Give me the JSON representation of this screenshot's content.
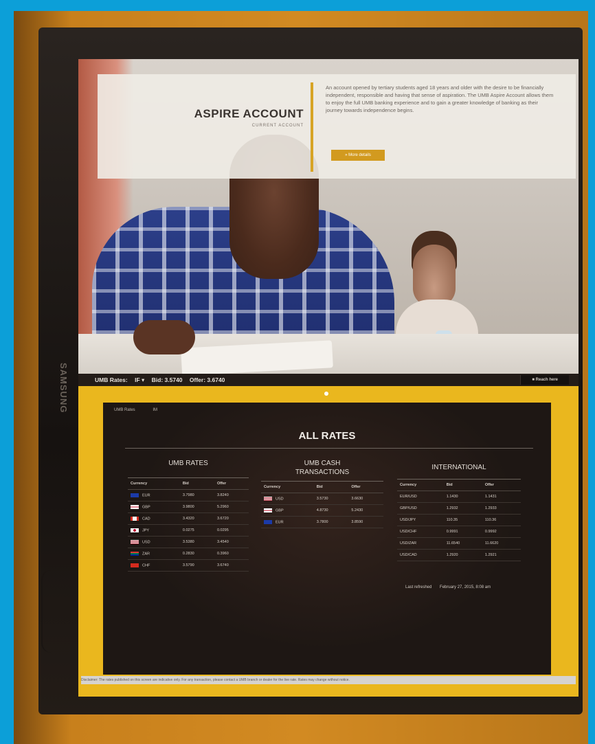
{
  "device": {
    "brand": "SAMSUNG"
  },
  "hero": {
    "title": "ASPIRE ACCOUNT",
    "subtitle": "CURRENT ACCOUNT",
    "body": "An account opened by tertiary students aged 18 years and older with the desire to be financially independent, responsible and having that sense of aspiration. The UMB Aspire Account allows them to enjoy the full UMB banking experience and to gain a greater knowledge of banking as their journey towards independence begins.",
    "button_label": "» More details"
  },
  "ticker": {
    "label": "UMB Rates:",
    "currency": "IF ▾",
    "bid": "Bid: 3.5740",
    "offer": "Offer: 3.6740",
    "reach_label": "■ Reach here"
  },
  "rates": {
    "header_label": "UMB Rates",
    "header_value": "IM",
    "title": "ALL RATES",
    "umb": {
      "title": "UMB RATES",
      "columns": [
        "Currency",
        "Bid",
        "Offer"
      ],
      "rows": [
        {
          "flag": "eu",
          "code": "EUR",
          "bid": "3.7980",
          "offer": "3.8240"
        },
        {
          "flag": "gb",
          "code": "GBP",
          "bid": "3.9800",
          "offer": "5.2960"
        },
        {
          "flag": "ca",
          "code": "CAD",
          "bid": "3.4320",
          "offer": "3.6720"
        },
        {
          "flag": "jp",
          "code": "JPY",
          "bid": "0.0275",
          "offer": "0.0295"
        },
        {
          "flag": "us",
          "code": "USD",
          "bid": "3.5380",
          "offer": "3.4540"
        },
        {
          "flag": "za",
          "code": "ZAR",
          "bid": "0.2830",
          "offer": "0.3960"
        },
        {
          "flag": "ch",
          "code": "CHF",
          "bid": "3.5790",
          "offer": "3.6740"
        }
      ]
    },
    "cash": {
      "title_line1": "UMB CASH",
      "title_line2": "TRANSACTIONS",
      "columns": [
        "Currency",
        "Bid",
        "Offer"
      ],
      "rows": [
        {
          "flag": "us",
          "code": "USD",
          "bid": "3.5730",
          "offer": "3.6630"
        },
        {
          "flag": "gb",
          "code": "GBP",
          "bid": "4.8730",
          "offer": "5.2430"
        },
        {
          "flag": "eu",
          "code": "EUR",
          "bid": "3.7800",
          "offer": "3.8590"
        }
      ]
    },
    "international": {
      "title": "INTERNATIONAL",
      "columns": [
        "Currency",
        "Bid",
        "Offer"
      ],
      "rows": [
        {
          "code": "EUR/USD",
          "bid": "1.1430",
          "offer": "1.1431"
        },
        {
          "code": "GBP/USD",
          "bid": "1.2932",
          "offer": "1.2933"
        },
        {
          "code": "USD/JPY",
          "bid": "110.35",
          "offer": "110.36"
        },
        {
          "code": "USD/CHF",
          "bid": "0.9991",
          "offer": "0.9992"
        },
        {
          "code": "USD/ZAR",
          "bid": "11.6540",
          "offer": "11.6620"
        },
        {
          "code": "USD/CAD",
          "bid": "1.2920",
          "offer": "1.2921"
        }
      ]
    },
    "last_refresh_label": "Last refreshed",
    "last_refresh_value": "February 27, 2015, 8:08 am"
  },
  "statusbar_text": "Disclaimer: The rates published on this screen are indicative only. For any transaction, please contact a UMB branch or dealer for the live rate. Rates may change without notice."
}
